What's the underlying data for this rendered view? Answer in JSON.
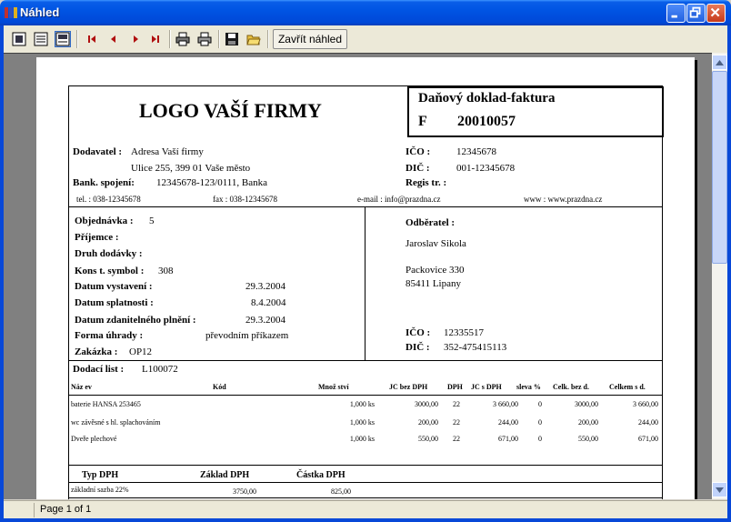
{
  "window": {
    "title": "Náhled"
  },
  "toolbar": {
    "close_preview": "Zavřít náhled"
  },
  "status": {
    "page": "Page 1 of 1"
  },
  "invoice": {
    "logo": "LOGO VAŠÍ FIRMY",
    "doc_title": "Daňový doklad-faktura",
    "doc_prefix": "F",
    "doc_number": "20010057",
    "supplier": {
      "label": "Dodavatel :",
      "line1": "Adresa Vaší firmy",
      "line2": "Ulice 255, 399 01  Vaše město",
      "bank_label": "Bank. spojení:",
      "bank": "12345678-123/0111, Banka",
      "ico_label": "IČO :",
      "ico": "12345678",
      "dic_label": "DIČ :",
      "dic": "001-12345678",
      "regist_label": "Regis tr. :",
      "tel": "tel. : 038-12345678",
      "fax": "fax : 038-12345678",
      "email": "e-mail : info@prazdna.cz",
      "www": "www : www.prazdna.cz"
    },
    "order": {
      "objednavka_label": "Objednávka :",
      "objednavka": "5",
      "prijemce_label": "Příjemce :",
      "druh_label": "Druh dodávky :",
      "konst_label": "Kons t. symbol :",
      "konst": "308",
      "vystaveni_label": "Datum vystavení :",
      "vystaveni": "29.3.2004",
      "splatnosti_label": "Datum splatnosti :",
      "splatnosti": "8.4.2004",
      "zdanit_label": "Datum zdanitelného plnění :",
      "zdanit": "29.3.2004",
      "forma_label": "Forma úhrady :",
      "forma": "převodním příkazem",
      "zakazka_label": "Zakázka :",
      "zakazka": "OP12",
      "dodaci_label": "Dodací list :",
      "dodaci": "L100072"
    },
    "customer": {
      "label": "Odběratel :",
      "name": "Jaroslav Sikola",
      "street": "Packovice 330",
      "city": "85411    Lipany",
      "ico_label": "IČO :",
      "ico": "12335517",
      "dic_label": "DIČ :",
      "dic": "352-475415113"
    },
    "columns": [
      "Náz ev",
      "Kód",
      "Množ ství",
      "JC bez DPH",
      "DPH",
      "JC s DPH",
      "sleva %",
      "Celk. bez d.",
      "Celkem s d."
    ],
    "rows": [
      {
        "name": "baterie HANSA 253465",
        "qty": "1,000 ks",
        "jc": "3000,00",
        "dph": "22",
        "jcs": "3 660,00",
        "sleva": "0",
        "celk": "3000,00",
        "celks": "3 660,00"
      },
      {
        "name": "wc závěsné s hl. splachováním",
        "qty": "1,000 ks",
        "jc": "200,00",
        "dph": "22",
        "jcs": "244,00",
        "sleva": "0",
        "celk": "200,00",
        "celks": "244,00"
      },
      {
        "name": "Dveře plechové",
        "qty": "1,000 ks",
        "jc": "550,00",
        "dph": "22",
        "jcs": "671,00",
        "sleva": "0",
        "celk": "550,00",
        "celks": "671,00"
      }
    ],
    "vat": {
      "col1": "Typ DPH",
      "col2": "Základ DPH",
      "col3": "Částka DPH",
      "type": "základní sazba 22%",
      "base": "3750,00",
      "amount": "825,00"
    }
  }
}
